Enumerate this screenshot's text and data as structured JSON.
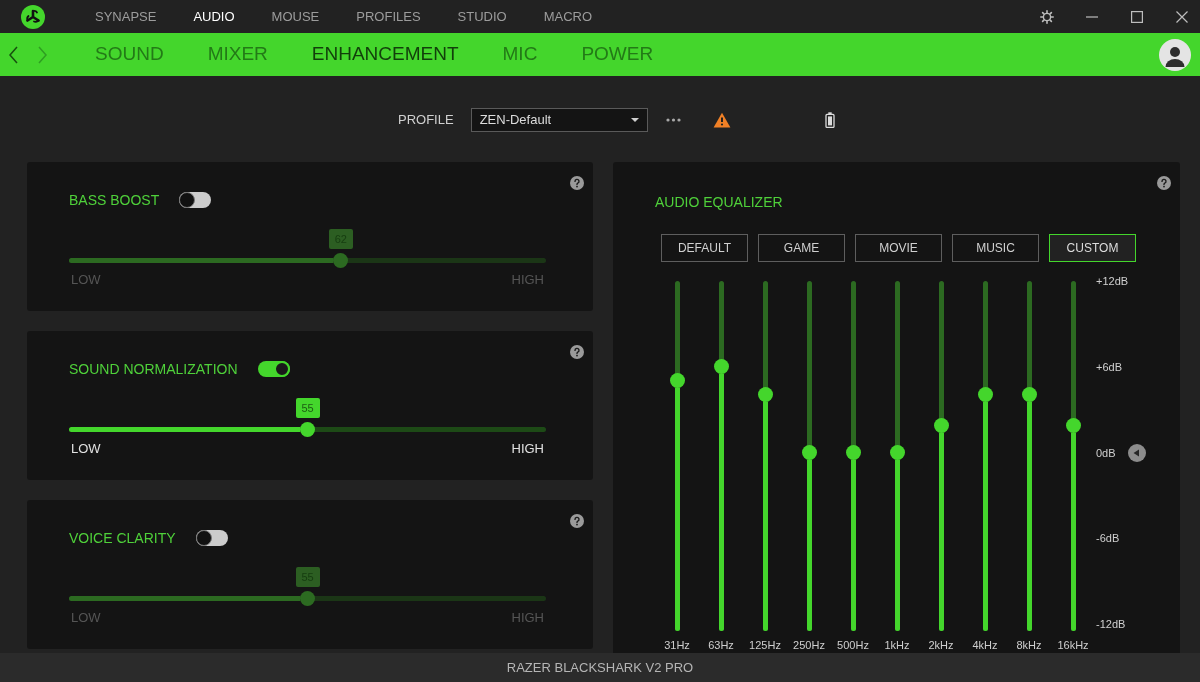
{
  "top_nav": {
    "items": [
      {
        "label": "SYNAPSE",
        "selected": false
      },
      {
        "label": "AUDIO",
        "selected": true
      },
      {
        "label": "MOUSE",
        "selected": false
      },
      {
        "label": "PROFILES",
        "selected": false
      },
      {
        "label": "STUDIO",
        "selected": false
      },
      {
        "label": "MACRO",
        "selected": false
      }
    ]
  },
  "sub_nav": {
    "arrows": [
      {
        "kind": "back",
        "disabled": false
      },
      {
        "kind": "forward",
        "disabled": true
      }
    ],
    "tabs": [
      {
        "label": "SOUND",
        "selected": false
      },
      {
        "label": "MIXER",
        "selected": false
      },
      {
        "label": "ENHANCEMENT",
        "selected": true
      },
      {
        "label": "MIC",
        "selected": false
      },
      {
        "label": "POWER",
        "selected": false
      }
    ]
  },
  "profile": {
    "label": "PROFILE",
    "value": "ZEN-Default"
  },
  "enhancements": [
    {
      "title": "BASS BOOST",
      "on": false,
      "value": "62",
      "level": 0.57,
      "low": "LOW",
      "high": "HIGH"
    },
    {
      "title": "SOUND NORMALIZATION",
      "on": true,
      "value": "55",
      "level": 0.5,
      "low": "LOW",
      "high": "HIGH"
    },
    {
      "title": "VOICE CLARITY",
      "on": false,
      "value": "55",
      "level": 0.5,
      "low": "LOW",
      "high": "HIGH"
    }
  ],
  "equalizer": {
    "title": "AUDIO EQUALIZER",
    "presets": [
      {
        "label": "DEFAULT",
        "selected": false
      },
      {
        "label": "GAME",
        "selected": false
      },
      {
        "label": "MOVIE",
        "selected": false
      },
      {
        "label": "MUSIC",
        "selected": false
      },
      {
        "label": "CUSTOM",
        "selected": true
      }
    ],
    "scale": [
      "+12dB",
      "+6dB",
      "0dB",
      "-6dB",
      "-12dB"
    ],
    "bands": [
      {
        "label": "31Hz",
        "level": 0.71
      },
      {
        "label": "63Hz",
        "level": 0.75
      },
      {
        "label": "125Hz",
        "level": 0.67
      },
      {
        "label": "250Hz",
        "level": 0.5
      },
      {
        "label": "500Hz",
        "level": 0.5
      },
      {
        "label": "1kHz",
        "level": 0.5
      },
      {
        "label": "2kHz",
        "level": 0.58
      },
      {
        "label": "4kHz",
        "level": 0.67
      },
      {
        "label": "8kHz",
        "level": 0.67
      },
      {
        "label": "16kHz",
        "level": 0.58
      }
    ]
  },
  "status_bar": {
    "device": "RAZER BLACKSHARK V2 PRO"
  }
}
